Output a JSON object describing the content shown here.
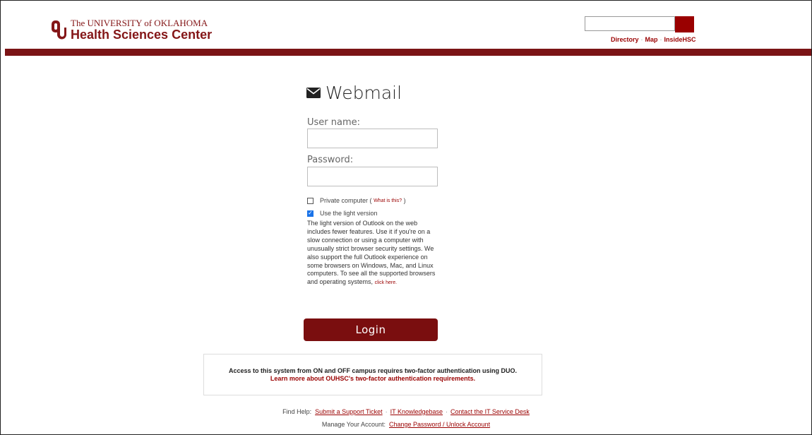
{
  "header": {
    "logo_line1": "The UNIVERSITY of OKLAHOMA",
    "logo_line2": "Health Sciences Center",
    "search_placeholder": "",
    "links": [
      "Directory",
      "Map",
      "InsideHSC"
    ],
    "link_separator": "·"
  },
  "login": {
    "title": "Webmail",
    "username_label": "User name:",
    "username_value": "",
    "password_label": "Password:",
    "password_value": "",
    "private_computer_label": "Private computer",
    "private_computer_open": "(",
    "private_computer_link": "What is this?",
    "private_computer_close": ")",
    "private_computer_checked": false,
    "light_version_label": "Use the light version",
    "light_version_checked": true,
    "light_description": "The light version of Outlook on the web includes fewer features. Use it if you're on a slow connection or using a computer with unusually strict browser security settings. We also support the full Outlook experience on some browsers on Windows, Mac, and Linux computers. To see all the supported browsers and operating systems,",
    "light_description_link": "click here.",
    "login_button": "Login"
  },
  "notice": {
    "line1": "Access to this system from ON and OFF campus requires two-factor authentication using DUO.",
    "line2": "Learn more about OUHSC's two-factor authentication requirements."
  },
  "help": {
    "find_help_label": "Find Help:",
    "links": [
      "Submit a Support Ticket",
      "IT Knowledgebase",
      "Contact the IT Service Desk"
    ],
    "separator": "·",
    "manage_label": "Manage Your Account:",
    "manage_link": "Change Password / Unlock Account"
  },
  "colors": {
    "brand_crimson": "#841617",
    "bar": "#7b1416",
    "button": "#7a0e0f",
    "checkbox_checked": "#1a73e8"
  }
}
